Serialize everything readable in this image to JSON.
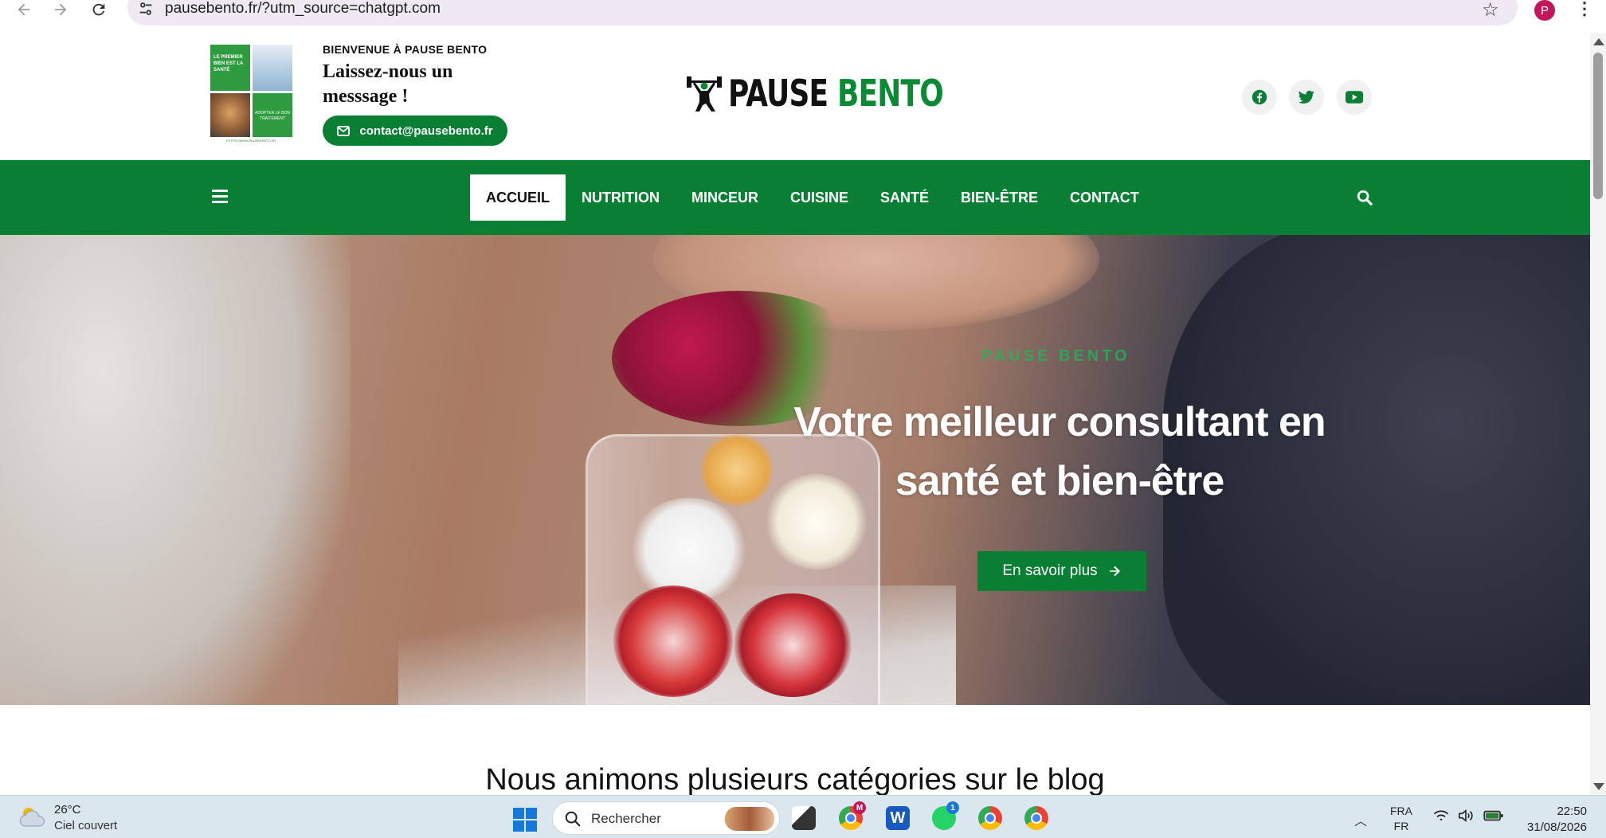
{
  "browser": {
    "url": "pausebento.fr/?utm_source=chatgpt.com",
    "profile_initial": "P"
  },
  "header": {
    "welcome": "BIENVENUE À PAUSE BENTO",
    "message_title": "Laissez-nous un messsage !",
    "email": "contact@pausebento.fr",
    "promo_caption": "HTTPS://WWW.PAUSEBENTO.FR",
    "promo_tile_1": "LE PREMIER BIEN EST LA SANTÉ",
    "promo_tile_2": "ADOPTER LE BON TRAITEMENT",
    "logo_part1": "PAUSE",
    "logo_part2": "BENTO",
    "social": [
      "facebook-icon",
      "twitter-icon",
      "youtube-icon"
    ]
  },
  "nav": {
    "items": [
      "ACCUEIL",
      "NUTRITION",
      "MINCEUR",
      "CUISINE",
      "SANTÉ",
      "BIEN-ÊTRE",
      "CONTACT"
    ],
    "active_index": 0
  },
  "hero": {
    "kicker": "PAUSE BENTO",
    "title": "Votre meilleur consultant en santé et bien-être",
    "button": "En savoir plus"
  },
  "section": {
    "title": "Nous animons plusieurs catégories sur le blog"
  },
  "taskbar": {
    "temperature": "26°C",
    "weather": "Ciel couvert",
    "search_placeholder": "Rechercher",
    "lang_top": "FRA",
    "lang_bottom": "FR",
    "time": "22:50",
    "date": "31/08/2026",
    "badge_mail": "M",
    "badge_whatsapp": "1"
  },
  "colors": {
    "brand_green": "#087f33",
    "logo_green": "#0b8a34"
  }
}
